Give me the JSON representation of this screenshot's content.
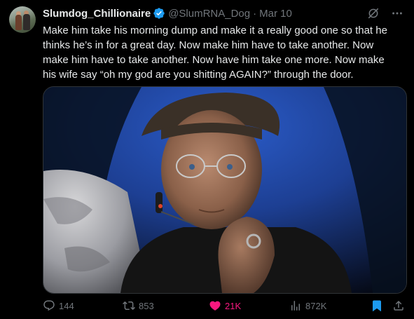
{
  "tweet": {
    "author": {
      "display_name": "Slumdog_Chillionaire",
      "handle": "@SlumRNA_Dog",
      "separator": "·",
      "time": "Mar 10"
    },
    "text": "Make him take his morning dump and make it a really good one so that he thinks he’s in for a great day. Now make him have to take another. Now make him have to take another. Now have him take one more. Now make his wife say “oh my god are you shitting AGAIN?” through the door.",
    "icons": {
      "verified": "verified-badge-icon",
      "grok": "grok-icon",
      "more": "more-icon"
    },
    "colors": {
      "background": "#000000",
      "text": "#e7e9ea",
      "secondary": "#71767b",
      "verified": "#1d9bf0",
      "like": "#f91880",
      "bookmark": "#1d9bf0"
    },
    "actions": {
      "replies": "144",
      "reposts": "853",
      "likes": "21K",
      "views": "872K",
      "liked": true,
      "bookmarked": true
    }
  }
}
